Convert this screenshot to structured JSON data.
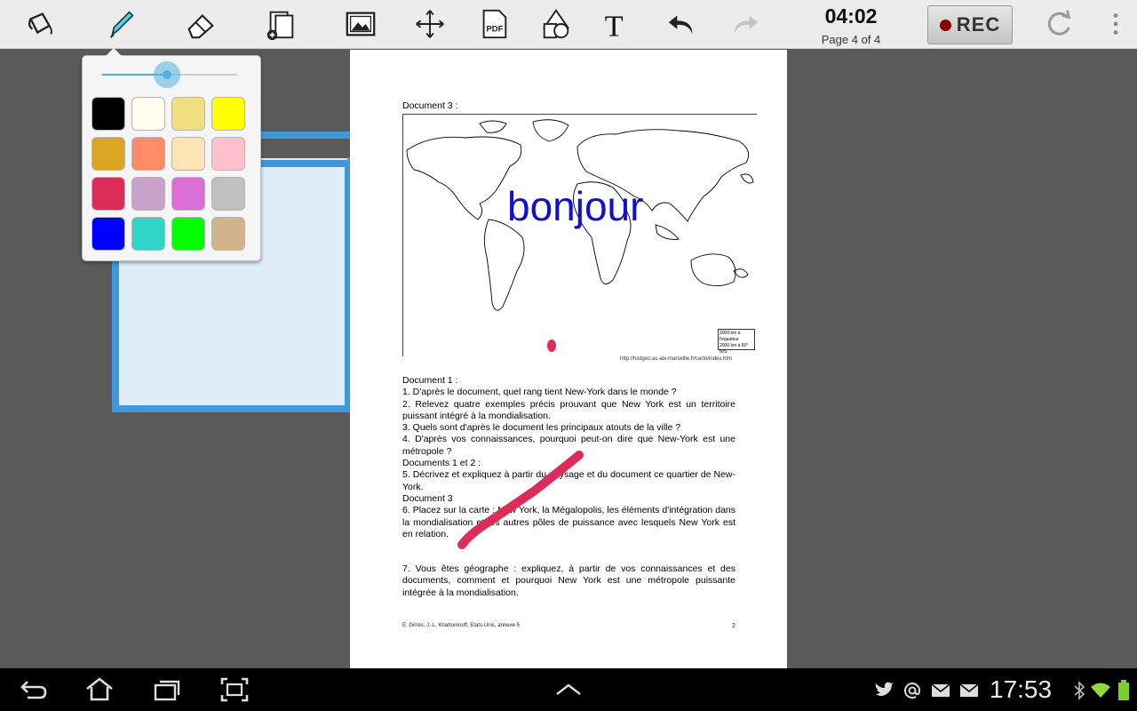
{
  "toolbar": {
    "tools": [
      {
        "name": "paint-bucket-icon"
      },
      {
        "name": "pen-icon"
      },
      {
        "name": "eraser-icon"
      },
      {
        "name": "add-page-icon"
      },
      {
        "name": "image-icon"
      },
      {
        "name": "move-icon"
      },
      {
        "name": "pdf-icon",
        "label": "PDF"
      },
      {
        "name": "shapes-icon"
      },
      {
        "name": "text-icon",
        "label": "T"
      },
      {
        "name": "undo-icon"
      },
      {
        "name": "redo-icon"
      }
    ],
    "time": "04:02",
    "page_indicator": "Page 4 of 4",
    "rec_label": "REC",
    "rec_color": "#8b0000"
  },
  "pen_popup": {
    "size_level": 0.48,
    "accent": "#4fb2e0",
    "colors": [
      "#000000",
      "#fffff0",
      "#f0e080",
      "#ffff00",
      "#daa520",
      "#ff8c69",
      "#ffe4b5",
      "#ffc0cb",
      "#dc2c5a",
      "#c8a2c8",
      "#da70d6",
      "#c0c0c0",
      "#0000ff",
      "#30d5c8",
      "#00ff00",
      "#d2b48c"
    ]
  },
  "document": {
    "doc3_title": "Document 3 :",
    "annotation_text": "bonjour",
    "map_url": "http://histgeo.ac-aix-marseille.fr/carto/index.htm",
    "map_scale": [
      "2000 km à l'équateur",
      "2000 km à 60° N/S"
    ],
    "questions": [
      "Document 1 :",
      "1. D'après le document, quel rang tient New-York dans le monde ?",
      "2. Relevez quatre exemples précis prouvant que New York est un territoire puissant intégré à la mondialisation.",
      "3. Quels sont d'après le document les principaux atouts de la ville ?",
      "4. D'après vos connaissances, pourquoi peut-on dire que New-York est une métropole ?",
      "Documents 1 et 2 :",
      "5. Décrivez et expliquez à partir du paysage et du document ce quartier de New-York.",
      "Document 3",
      "6. Placez sur la carte : New York, la Mégalopolis, les éléments d'intégration dans la mondialisation et les autres pôles de puissance avec lesquels New York est en relation.",
      "",
      "7. Vous êtes géographe : expliquez, à partir de vos connaissances et des documents, comment et pourquoi New York est une métropole puissante intégrée à la mondialisation."
    ],
    "footer_left": "E. Girres, J.-L. Khartomnoff, Etats-Unis, annexe 5",
    "footer_right": "2"
  },
  "navbar": {
    "clock": "17:53",
    "buttons": [
      "back-icon",
      "home-icon",
      "recent-apps-icon",
      "screenshot-icon",
      "up-arrow-icon"
    ],
    "status_icons": [
      "twitter-icon",
      "at-icon",
      "mail-icon",
      "mail-icon",
      "bluetooth-icon",
      "wifi-icon",
      "battery-icon"
    ],
    "battery_color": "#7ecf2c"
  }
}
